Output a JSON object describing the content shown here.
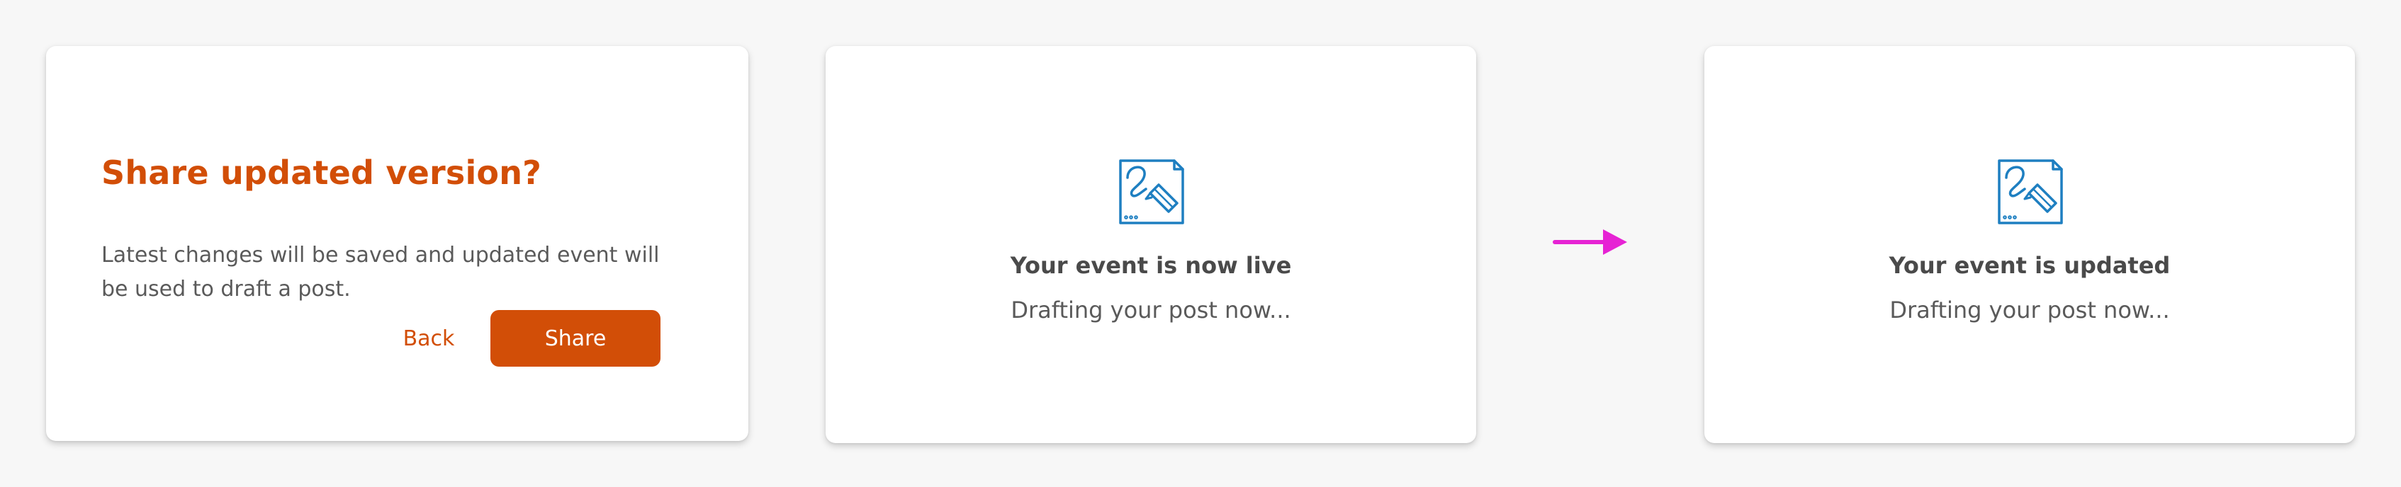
{
  "colors": {
    "accent": "#d24e07",
    "icon_blue": "#1e7fc1",
    "arrow_magenta": "#e623d4"
  },
  "dialog": {
    "title": "Share updated version?",
    "body": "Latest changes will be saved and updated event will be used to draft a post.",
    "back_label": "Back",
    "share_label": "Share"
  },
  "status_live": {
    "icon": "draft-document-pen-icon",
    "heading": "Your event is now live",
    "subtext": "Drafting your post now..."
  },
  "flow": {
    "icon": "right-arrow-icon"
  },
  "status_updated": {
    "icon": "draft-document-pen-icon",
    "heading": "Your event is updated",
    "subtext": "Drafting your post now..."
  }
}
